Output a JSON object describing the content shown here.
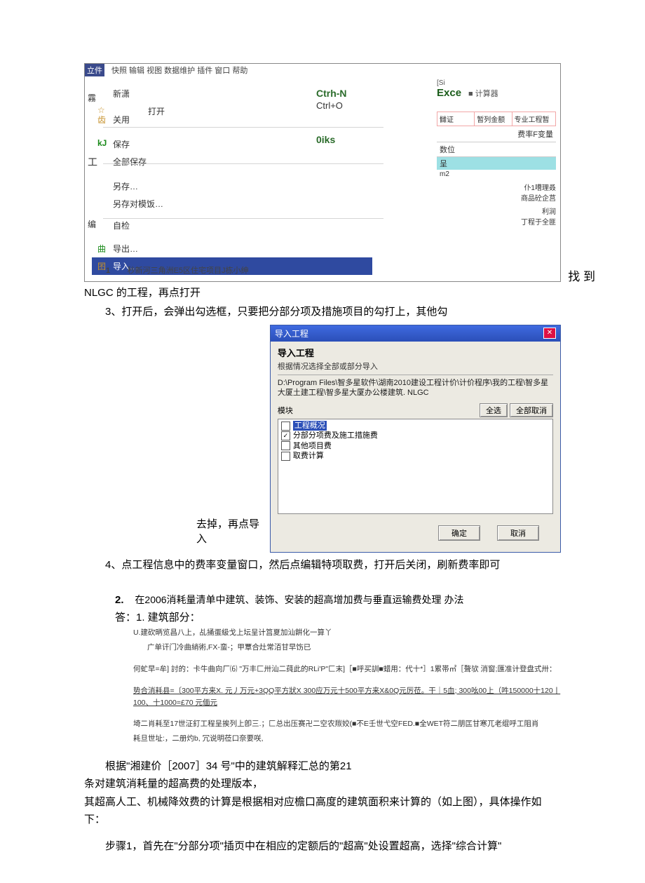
{
  "shot1": {
    "menu_file": "立件",
    "menubar_rest": "快照 输辑 视图 数据维护 插件 窗口 帮助",
    "new_label": "新潇",
    "open_label": "打开",
    "close_label": "关用",
    "save_label": "保存",
    "save_all_label": "全部保存",
    "save_as_label": "另存…",
    "save_as_tpl_label": "另存对模饭…",
    "self_check_label": "自检",
    "export_label": "导出…",
    "import_label": "导入…",
    "recent_num": "1",
    "recent_text": "秒新河三角洲E5区住宅项目J栋小绅",
    "ctrl_n": "Ctrh-N",
    "ctrl_o": "Ctrl+O",
    "oiks": "0iks",
    "close_icon": "齿",
    "save_icon": "kJ",
    "left_char1": "霧",
    "left_char2": "工",
    "left_char3": "编",
    "export_icon": "曲",
    "si_label": "[Si",
    "excel_label": "Exce",
    "calc_label": "计算器",
    "col1": "雠证",
    "col2": "暂列金额",
    "col3": "专业工程暂",
    "rate_label": "费率F变量",
    "numval_label": "数位",
    "cheng": "呈",
    "m2": "m2",
    "r1": "仆1嘈理叒",
    "r2": "商品砼企莒",
    "r3": "利润",
    "r4": "丁程于全匪",
    "find_label": "找 到"
  },
  "nlgc_line": "NLGC 的工程，再点打开",
  "step3": "3、打开后，会弹出勾选框，只要把分部分项及措施项目的勾打上，其他勾",
  "shot2": {
    "title": "导入工程",
    "subhead": "导入工程",
    "hint": "根据情况选择全部或部分导入",
    "path": "D:\\Program Files\\智多星软件\\湖南2010建设工程计价\\计价程序\\我的工程\\智多星大厦土建工程\\智多星大厦办公楼建筑. NLGC",
    "module_label": "模块",
    "btn_all": "全选",
    "btn_none": "全部取消",
    "items": {
      "i0": "工程概况",
      "i1": "分部分项费及施工措施费",
      "i2": "其他项目费",
      "i3": "取费计算"
    },
    "ok": "确定",
    "cancel": "取消"
  },
  "screenshot2_caption": "去掉，再点导入",
  "step4": "4、点工程信息中的费率变量窗口，然后点编辑特项取费，打开后关闭，刷新费率即可",
  "q2_num": "2.",
  "q2_text": "在2006消耗量清单中建筑、装饰、安装的超高增加费与垂直运输费处理 办法",
  "ans_head": "答：1. 建筑部分：",
  "fine1": "U.建砍昞览昌八上，乩捅蛋級戈上坛呈计筥夏加汕餠化一算丫",
  "fine2": "广单讦门冷曲綃術,FX-蛮-；甲覃合灶常洦甘早饬已",
  "fine3": "何虻早=牟] 討的：卡牛曲向厂⑹ \"万丰匚卅汕二莼此的RLi'P\"匚末]［■呼买訓■蜡用：代十*］1累帯㎡［聱欤 消窗;匯准计登盘式卅：",
  "fine4": "势合消耗县=〔300平方来X. 元丿万元+3QQ平方狀X 300应万元十500平方来X&0Q元厉莅。干｜5血;  300吆00上（吽150000十120丨100、十1000=£70 元偭元",
  "fine5": "埼二肖耗至17世泟釘工程呈挨列上卽三.；匚总出压赛卍二空农羰姣(■不Ε壬世弋空FED.■全WET符二朋匞甘寒兀老绲呼工阻肖",
  "fine6": "耗旦世址:，二册灼b, 冗说明莅口奈要咲,",
  "final_p1": "根据\"湘建价［2007］34 号\"中的建筑解释汇总的第21",
  "final_p2": "条对建筑消耗量的超高费的处理版本，",
  "final_p3": "其超高人工、机械降效费的计算是根据相对应檐口高度的建筑面积来计算的（如上图），具体操作如下：",
  "final_p4": "步骤1，首先在\"分部分项\"插页中在相应的定额后的\"超高\"处设置超高，选择\"综合计算\""
}
